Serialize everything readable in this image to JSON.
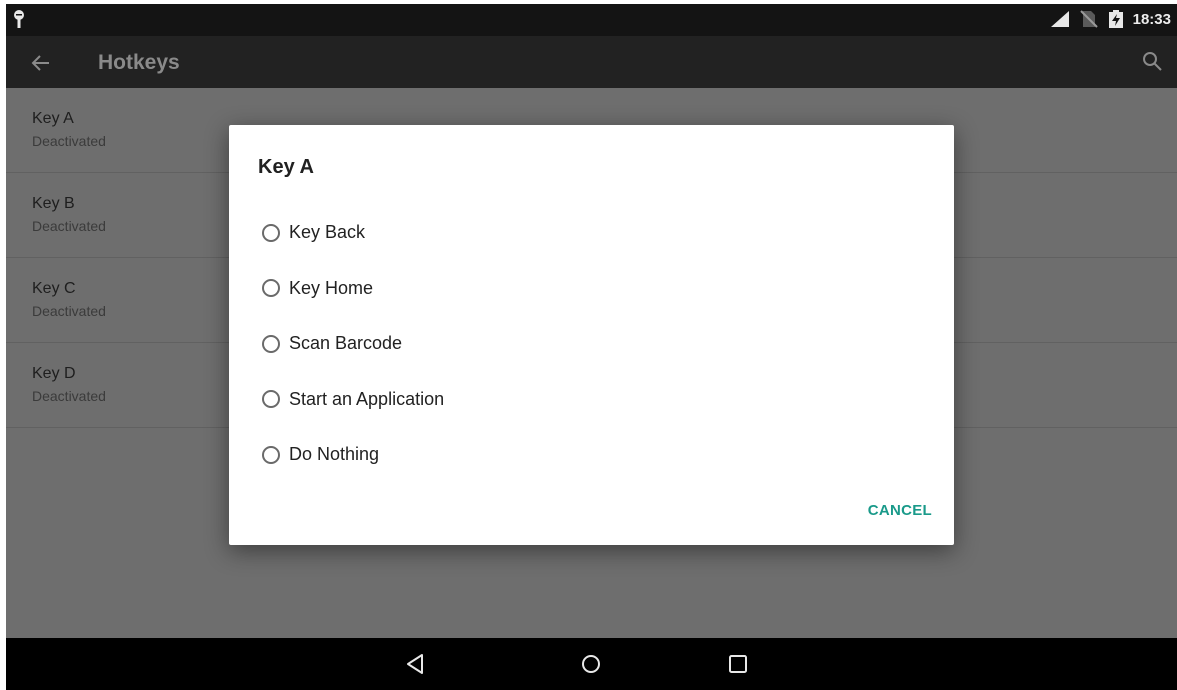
{
  "status_bar": {
    "time": "18:33",
    "icons": [
      "android-debug-icon",
      "signal-icon",
      "no-sim-icon",
      "battery-charging-icon"
    ]
  },
  "app_bar": {
    "title": "Hotkeys",
    "icons": [
      "back-arrow-icon",
      "search-icon"
    ]
  },
  "list": {
    "items": [
      {
        "label": "Key A",
        "status": "Deactivated"
      },
      {
        "label": "Key B",
        "status": "Deactivated"
      },
      {
        "label": "Key C",
        "status": "Deactivated"
      },
      {
        "label": "Key D",
        "status": "Deactivated"
      }
    ]
  },
  "dialog": {
    "title": "Key A",
    "options": [
      {
        "label": "Key Back",
        "selected": false
      },
      {
        "label": "Key Home",
        "selected": false
      },
      {
        "label": "Scan Barcode",
        "selected": false
      },
      {
        "label": "Start an Application",
        "selected": false
      },
      {
        "label": "Do Nothing",
        "selected": false
      }
    ],
    "cancel_label": "CANCEL"
  },
  "nav_bar": {
    "icons": [
      "nav-back-icon",
      "nav-home-icon",
      "nav-recents-icon"
    ]
  },
  "colors": {
    "accent": "#1a9a8a",
    "scrim": "#6e6e6e",
    "status_bar": "#141414",
    "app_bar": "#222222"
  }
}
